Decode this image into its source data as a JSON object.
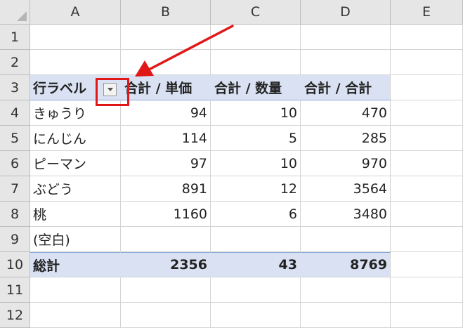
{
  "columns": [
    "A",
    "B",
    "C",
    "D",
    "E"
  ],
  "rows": [
    "1",
    "2",
    "3",
    "4",
    "5",
    "6",
    "7",
    "8",
    "9",
    "10",
    "11",
    "12"
  ],
  "pivot": {
    "headers": {
      "row_label": "行ラベル",
      "sum_price": "合計 / 単価",
      "sum_qty": "合計 / 数量",
      "sum_total": "合計 / 合計"
    },
    "items": [
      {
        "label": "きゅうり",
        "price": "94",
        "qty": "10",
        "total": "470"
      },
      {
        "label": "にんじん",
        "price": "114",
        "qty": "5",
        "total": "285"
      },
      {
        "label": "ピーマン",
        "price": "97",
        "qty": "10",
        "total": "970"
      },
      {
        "label": "ぶどう",
        "price": "891",
        "qty": "12",
        "total": "3564"
      },
      {
        "label": "桃",
        "price": "1160",
        "qty": "6",
        "total": "3480"
      },
      {
        "label": "(空白)",
        "price": "",
        "qty": "",
        "total": ""
      }
    ],
    "grand_total": {
      "label": "総計",
      "price": "2356",
      "qty": "43",
      "total": "8769"
    }
  },
  "colors": {
    "pivot_header_fill": "#d9e1f2",
    "annotation": "#e01818"
  },
  "icons": {
    "filter_dropdown": "chevron-down-icon",
    "annotation_arrow": "arrow-icon"
  }
}
